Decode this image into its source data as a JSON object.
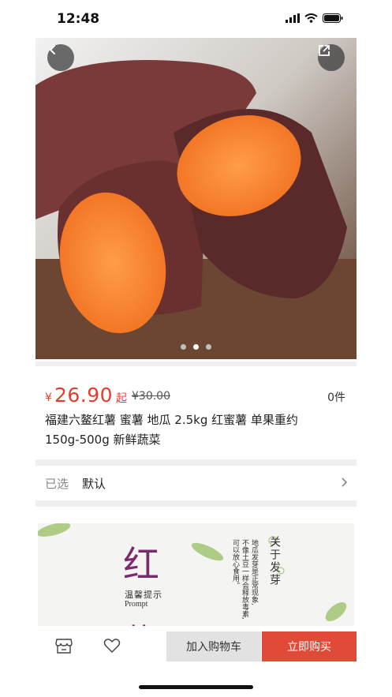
{
  "status_bar": {
    "time": "12:48"
  },
  "product": {
    "currency": "¥",
    "price": "26.90",
    "price_suffix": "起",
    "original_price": "¥30.00",
    "sold_count": "0件",
    "title": "福建六鳌红薯 蜜薯 地瓜 2.5kg 红蜜薯 单果重约150g-500g 新鲜蔬菜",
    "carousel": {
      "count": 3,
      "active_index": 1
    }
  },
  "spec": {
    "label": "已选",
    "value": "默认"
  },
  "banner": {
    "big_char": "红",
    "big_char_2": "薯",
    "small_text": "温馨提示",
    "english": "Prompt",
    "vertical_heading": "关于发芽",
    "vertical_lines": [
      "地瓜发芽是正常现象,",
      "不像土豆一样会释放毒素,",
      "可以放心食用。"
    ]
  },
  "actions": {
    "add_to_cart": "加入购物车",
    "buy_now": "立即购买"
  },
  "colors": {
    "accent": "#e14a37",
    "banner_text": "#7a2a6e"
  }
}
